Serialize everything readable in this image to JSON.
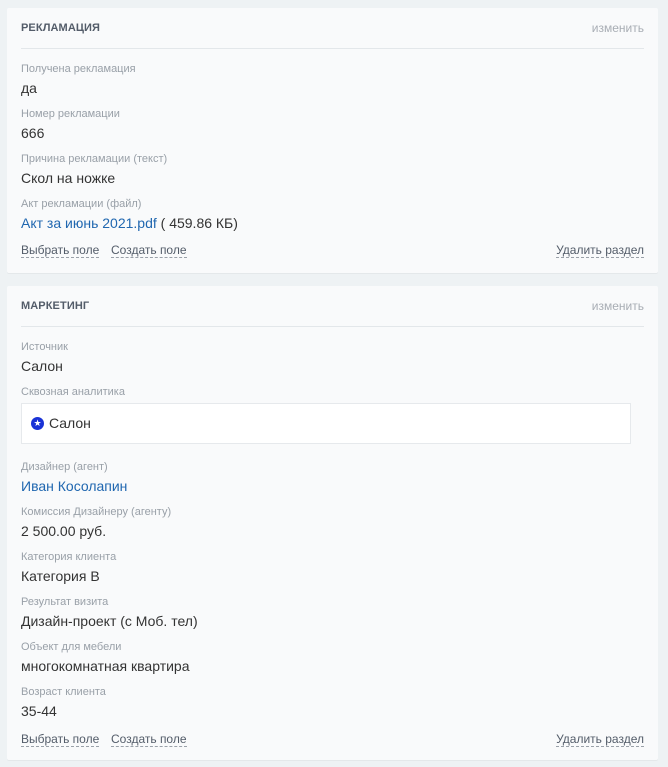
{
  "complaint": {
    "title": "РЕКЛАМАЦИЯ",
    "edit": "изменить",
    "fields": [
      {
        "label": "Получена рекламация",
        "value": "да"
      },
      {
        "label": "Номер рекламации",
        "value": "666"
      },
      {
        "label": "Причина рекламации (текст)",
        "value": "Скол на ножке"
      }
    ],
    "file": {
      "label": "Акт рекламации (файл)",
      "name": "Акт за июнь 2021.pdf",
      "size": "( 459.86 КБ)"
    },
    "actions": {
      "select": "Выбрать поле",
      "create": "Создать поле",
      "delete": "Удалить раздел"
    }
  },
  "marketing": {
    "title": "МАРКЕТИНГ",
    "edit": "изменить",
    "source": {
      "label": "Источник",
      "value": "Салон"
    },
    "analytics": {
      "label": "Сквозная аналитика",
      "value": "Салон",
      "icon": "star-icon",
      "icon_color": "#1a33d6"
    },
    "fields": [
      {
        "label": "Дизайнер (агент)",
        "value": "Иван Косолапин"
      },
      {
        "label": "Комиссия Дизайнеру (агенту)",
        "value": "2 500.00 руб."
      },
      {
        "label": "Категория клиента",
        "value": "Категория В"
      },
      {
        "label": "Результат визита",
        "value": "Дизайн-проект (с Моб. тел)"
      },
      {
        "label": "Объект для мебели",
        "value": "многокомнатная квартира"
      },
      {
        "label": "Возраст клиента",
        "value": "35-44"
      }
    ],
    "actions": {
      "select": "Выбрать поле",
      "create": "Создать поле",
      "delete": "Удалить раздел"
    }
  },
  "colors": {
    "link": "#2067b0",
    "label": "#99a0a8",
    "background": "#eef2f4",
    "card": "#f9fafb"
  }
}
